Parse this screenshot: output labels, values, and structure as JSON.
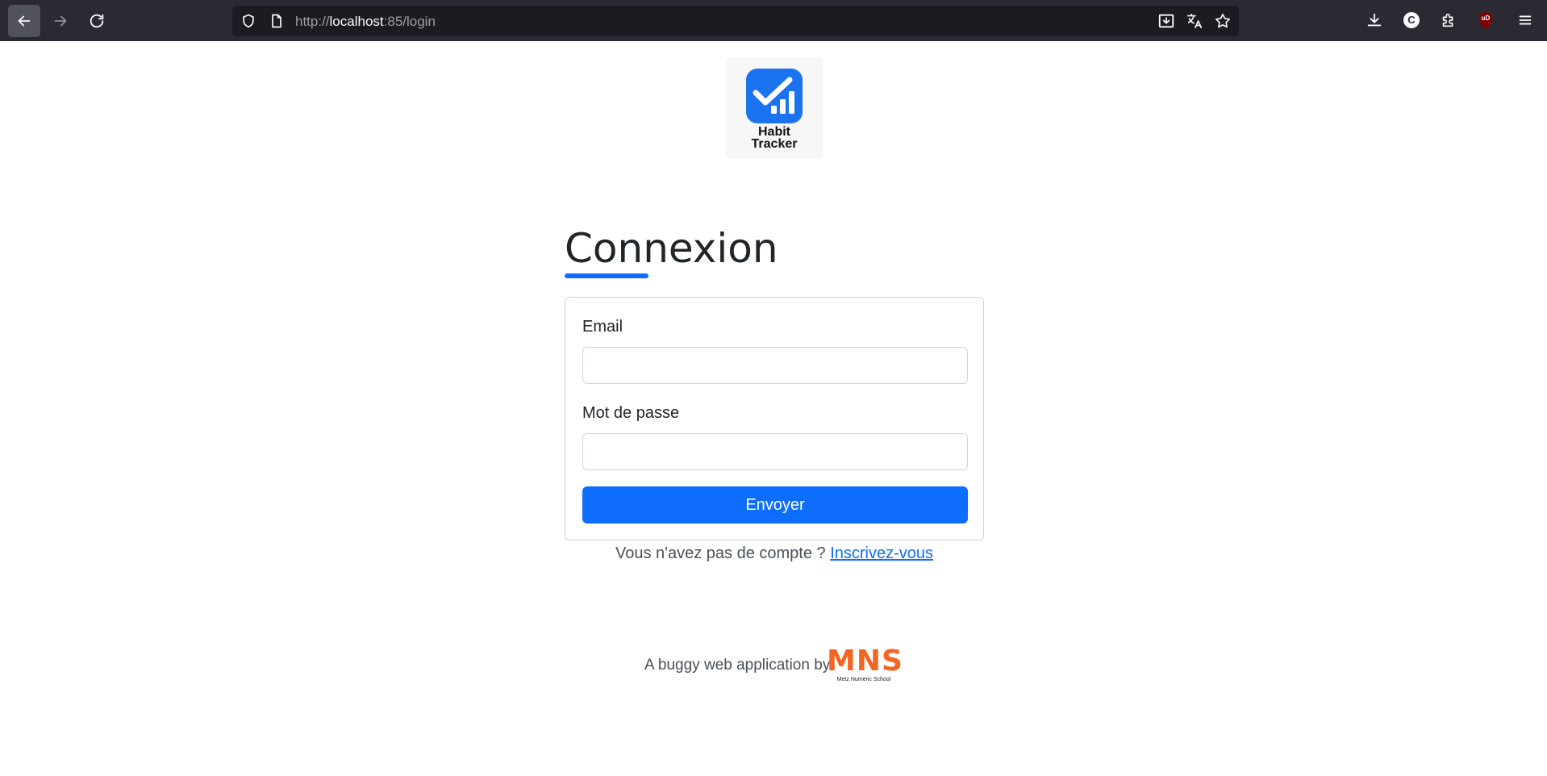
{
  "browser": {
    "url_scheme": "http://",
    "url_host": "localhost",
    "url_rest": ":85/login",
    "icons": {
      "back": "back-arrow-icon",
      "forward": "forward-arrow-icon",
      "reload": "reload-icon",
      "shield": "tracking-protection-shield-icon",
      "page": "page-info-icon",
      "install": "install-app-icon",
      "translate": "translate-icon",
      "bookmark": "bookmark-star-icon",
      "downloads": "downloads-icon",
      "account": "account-icon",
      "extensions": "extensions-icon",
      "ublock": "ublock-origin-icon",
      "menu": "hamburger-menu-icon"
    },
    "account_initial": "C",
    "ublock_label": "uD"
  },
  "logo": {
    "line1": "Habit",
    "line2": "Tracker"
  },
  "login": {
    "title": "Connexion",
    "email_label": "Email",
    "email_value": "",
    "password_label": "Mot de passe",
    "password_value": "",
    "submit_label": "Envoyer",
    "no_account_text": "Vous n'avez pas de compte ? ",
    "signup_link": "Inscrivez-vous"
  },
  "footer": {
    "text": "A buggy web application by",
    "brand": "MNS",
    "brand_caption": "Metz Numeric School"
  },
  "colors": {
    "primary": "#0d6efd",
    "toolbar": "#2b2a33",
    "urlbar": "#1c1b22",
    "logo_blue": "#1b73f0",
    "brand_orange": "#f26522"
  }
}
